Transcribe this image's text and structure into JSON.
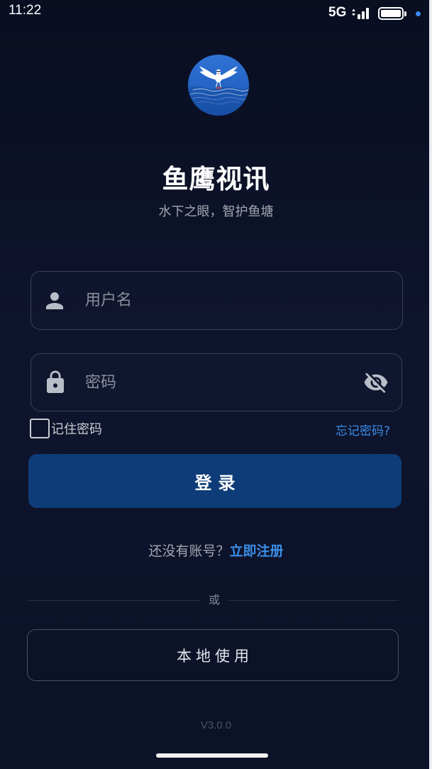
{
  "status_bar": {
    "time": "11:22",
    "network": "5G",
    "battery_percent": 100,
    "icons": {
      "signal": "signal-icon",
      "battery": "battery-icon",
      "dot": "notification-dot-icon"
    }
  },
  "app": {
    "name": "鱼鹰视讯",
    "slogan": "水下之眼，智护鱼塘",
    "logo_icon": "osprey-logo-icon"
  },
  "login_form": {
    "username": {
      "value": "",
      "placeholder": "用户名",
      "icon": "user-icon"
    },
    "password": {
      "value": "",
      "placeholder": "密码",
      "icon": "lock-icon",
      "toggle_icon": "eye-off-icon"
    },
    "remember": {
      "label": "记住密码",
      "checked": false
    },
    "forgot_password_label": "忘记密码?",
    "submit_label": "登录"
  },
  "register": {
    "prompt": "还没有账号？",
    "link_label": "立即注册"
  },
  "divider_label": "或",
  "local_use_label": "本地使用",
  "version": "V3.0.0",
  "colors": {
    "background": "#0c1227",
    "primary_button": "#0e3c78",
    "link": "#3b8ee8",
    "muted_text": "#a3a7b3",
    "input_border": "#3a4056"
  }
}
